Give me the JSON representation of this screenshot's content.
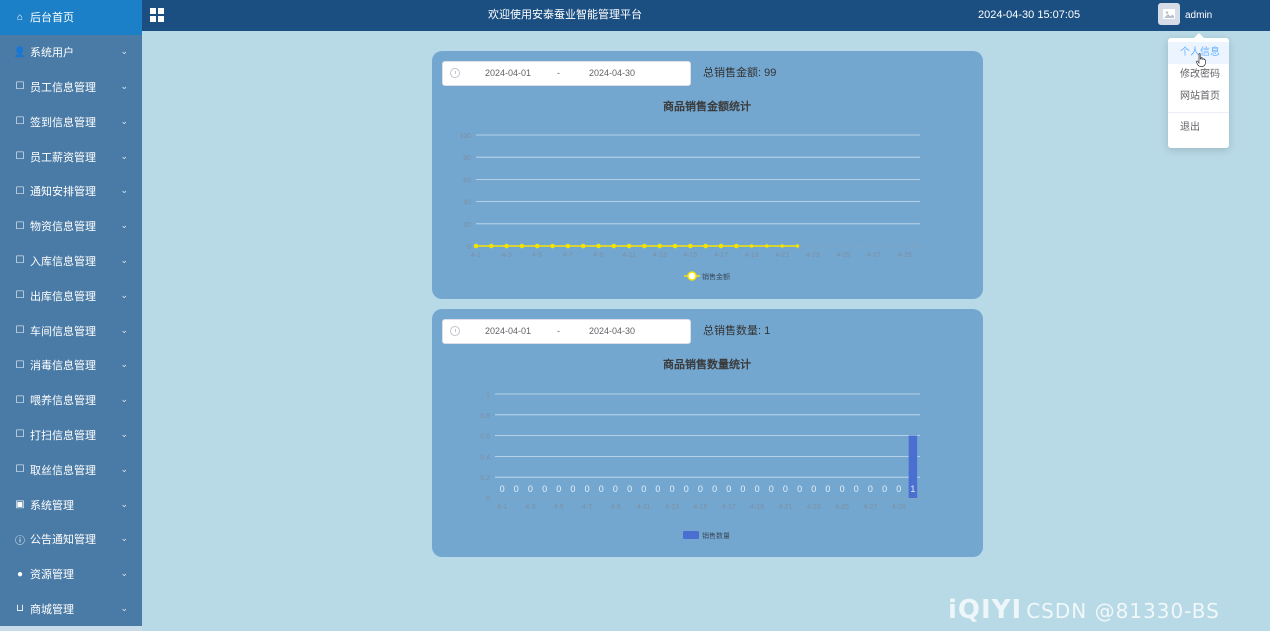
{
  "sidebar": {
    "items": [
      {
        "label": "后台首页",
        "icon": "home-icon",
        "active": true,
        "chevron": false
      },
      {
        "label": "系统用户",
        "icon": "user-icon",
        "active": false,
        "chevron": true
      },
      {
        "label": "员工信息管理",
        "icon": "doc-icon",
        "active": false,
        "chevron": true
      },
      {
        "label": "签到信息管理",
        "icon": "doc-icon",
        "active": false,
        "chevron": true
      },
      {
        "label": "员工薪资管理",
        "icon": "doc-icon",
        "active": false,
        "chevron": true
      },
      {
        "label": "通知安排管理",
        "icon": "doc-icon",
        "active": false,
        "chevron": true
      },
      {
        "label": "物资信息管理",
        "icon": "doc-icon",
        "active": false,
        "chevron": true
      },
      {
        "label": "入库信息管理",
        "icon": "doc-icon",
        "active": false,
        "chevron": true
      },
      {
        "label": "出库信息管理",
        "icon": "doc-icon",
        "active": false,
        "chevron": true
      },
      {
        "label": "车间信息管理",
        "icon": "doc-icon",
        "active": false,
        "chevron": true
      },
      {
        "label": "消毒信息管理",
        "icon": "doc-icon",
        "active": false,
        "chevron": true
      },
      {
        "label": "喂养信息管理",
        "icon": "doc-icon",
        "active": false,
        "chevron": true
      },
      {
        "label": "打扫信息管理",
        "icon": "doc-icon",
        "active": false,
        "chevron": true
      },
      {
        "label": "取丝信息管理",
        "icon": "doc-icon",
        "active": false,
        "chevron": true
      },
      {
        "label": "系统管理",
        "icon": "image-icon",
        "active": false,
        "chevron": true
      },
      {
        "label": "公告通知管理",
        "icon": "info-icon",
        "active": false,
        "chevron": true
      },
      {
        "label": "资源管理",
        "icon": "location-icon",
        "active": false,
        "chevron": true
      },
      {
        "label": "商城管理",
        "icon": "cart-icon",
        "active": false,
        "chevron": true
      }
    ]
  },
  "header": {
    "title": "欢迎使用安泰蚕业智能管理平台",
    "datetime": "2024-04-30 15:07:05",
    "username": "admin"
  },
  "dropdown": {
    "items": [
      "个人信息",
      "修改密码",
      "网站首页"
    ],
    "logout": "退出"
  },
  "cards": [
    {
      "date_start": "2024-04-01",
      "date_sep": "-",
      "date_end": "2024-04-30",
      "total_label": "总销售金额:",
      "total_value": "99"
    },
    {
      "date_start": "2024-04-01",
      "date_sep": "-",
      "date_end": "2024-04-30",
      "total_label": "总销售数量:",
      "total_value": "1"
    }
  ],
  "chart_data": [
    {
      "type": "line",
      "title": "商品销售金额统计",
      "x": [
        "4-1",
        "4-2",
        "4-3",
        "4-4",
        "4-5",
        "4-6",
        "4-7",
        "4-8",
        "4-9",
        "4-10",
        "4-11",
        "4-12",
        "4-13",
        "4-14",
        "4-15",
        "4-16",
        "4-17",
        "4-18",
        "4-19",
        "4-20",
        "4-21",
        "4-22",
        "4-23",
        "4-24",
        "4-25",
        "4-26",
        "4-27",
        "4-28",
        "4-29",
        "4-30"
      ],
      "x_tick_labels": [
        "4-1",
        "4-3",
        "4-5",
        "4-7",
        "4-9",
        "4-11",
        "4-13",
        "4-15",
        "4-17",
        "4-19",
        "4-21",
        "4-23",
        "4-25",
        "4-27",
        "4-29"
      ],
      "series": [
        {
          "name": "销售金额",
          "values": [
            0,
            0,
            0,
            0,
            0,
            0,
            0,
            0,
            0,
            0,
            0,
            0,
            0,
            0,
            0,
            0,
            0,
            0,
            0,
            0,
            0,
            0,
            null,
            null,
            null,
            null,
            null,
            null,
            null,
            null
          ]
        }
      ],
      "ylim": [
        0,
        100
      ],
      "y_ticks": [
        0,
        20,
        40,
        60,
        80,
        100
      ],
      "legend": "bottom-center",
      "colors": {
        "line": "#f5e400",
        "grid": "#c9dded",
        "axis_text": "#7f8fa0",
        "title": "#3b3b3b"
      }
    },
    {
      "type": "bar",
      "title": "商品销售数量统计",
      "categories": [
        "4-1",
        "4-2",
        "4-3",
        "4-4",
        "4-5",
        "4-6",
        "4-7",
        "4-8",
        "4-9",
        "4-10",
        "4-11",
        "4-12",
        "4-13",
        "4-14",
        "4-15",
        "4-16",
        "4-17",
        "4-18",
        "4-19",
        "4-20",
        "4-21",
        "4-22",
        "4-23",
        "4-24",
        "4-25",
        "4-26",
        "4-27",
        "4-28",
        "4-29",
        "4-30"
      ],
      "x_tick_labels": [
        "4-1",
        "4-3",
        "4-5",
        "4-7",
        "4-9",
        "4-11",
        "4-13",
        "4-15",
        "4-17",
        "4-19",
        "4-21",
        "4-23",
        "4-25",
        "4-27",
        "4-29"
      ],
      "series": [
        {
          "name": "销售数量",
          "values": [
            0,
            0,
            0,
            0,
            0,
            0,
            0,
            0,
            0,
            0,
            0,
            0,
            0,
            0,
            0,
            0,
            0,
            0,
            0,
            0,
            0,
            0,
            0,
            0,
            0,
            0,
            0,
            0,
            0,
            1
          ]
        }
      ],
      "data_labels": [
        "0",
        "0",
        "0",
        "0",
        "0",
        "0",
        "0",
        "0",
        "0",
        "0",
        "0",
        "0",
        "0",
        "0",
        "0",
        "0",
        "0",
        "0",
        "0",
        "0",
        "0",
        "0",
        "0",
        "0",
        "0",
        "0",
        "0",
        "0",
        "0",
        "1"
      ],
      "ylim": [
        0,
        1
      ],
      "y_ticks": [
        "0",
        "0.2",
        "0.4",
        "0.6",
        "0.8",
        "1"
      ],
      "legend": "bottom-center",
      "colors": {
        "bar": "#4a6fd1",
        "grid": "#c9dded",
        "axis_text": "#7f8fa0",
        "title": "#3b3b3b"
      }
    }
  ],
  "watermark": {
    "brand": "iQIYI",
    "text": "CSDN @81330-BS"
  }
}
